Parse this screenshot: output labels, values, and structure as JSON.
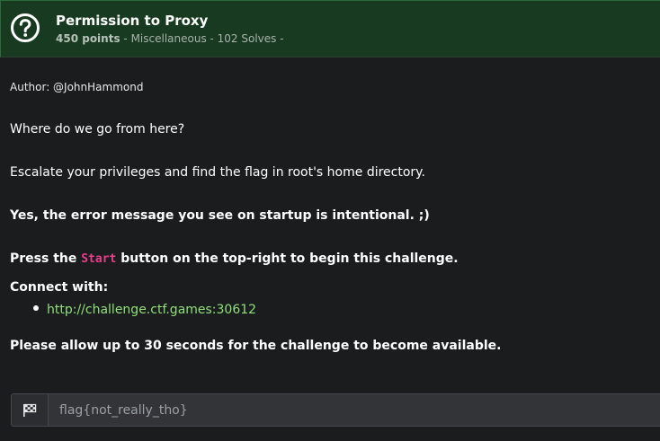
{
  "header": {
    "icon": "question-circle-icon",
    "title": "Permission to Proxy",
    "points": "450 points",
    "meta_rest": " - Miscellaneous - 102 Solves -",
    "background": "#183a21"
  },
  "description": {
    "author": "Author: @JohnHammond",
    "line1": "Where do we go from here?",
    "line2": "Escalate your privileges and find the flag in root's home directory.",
    "line3": "Yes, the error message you see on startup is intentional. ;)",
    "press_prefix": "Press the ",
    "start_code": "Start",
    "press_suffix": " button on the top-right to begin this challenge.",
    "connect_label": "Connect with:",
    "connect_link": "http://challenge.ctf.games:30612",
    "allow_text": "Please allow up to 30 seconds for the challenge to become available."
  },
  "flag_submit": {
    "icon": "checkered-flag-icon",
    "placeholder": "flag{not_really_tho}",
    "value": ""
  },
  "colors": {
    "link": "#8fe07a",
    "code": "#e83e8c",
    "page_bg": "#1b1c1e"
  }
}
